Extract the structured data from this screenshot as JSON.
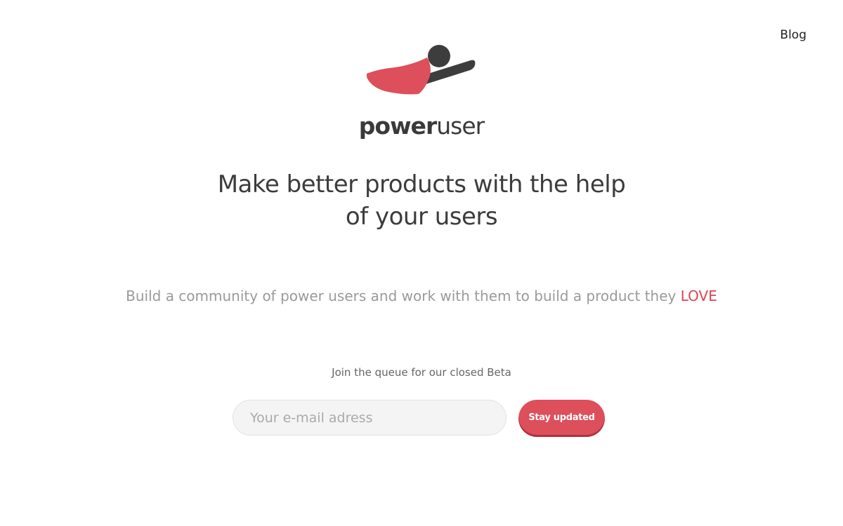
{
  "nav": {
    "blog_label": "Blog"
  },
  "brand": {
    "name_bold": "power",
    "name_light": "user",
    "logo_icon": "flying-superhero-cape-logo",
    "accent_color": "#dc4f5b",
    "dark_color": "#3d3d3d"
  },
  "hero": {
    "headline_line1": "Make better products with the help",
    "headline_line2": "of your users",
    "subline_text": "Build a community of power users and work with them to build a product they ",
    "subline_highlight": "LOVE"
  },
  "signup": {
    "queue_text": "Join the queue for our closed Beta",
    "email_placeholder": "Your e-mail adress",
    "email_value": "",
    "button_label": "Stay updated"
  }
}
